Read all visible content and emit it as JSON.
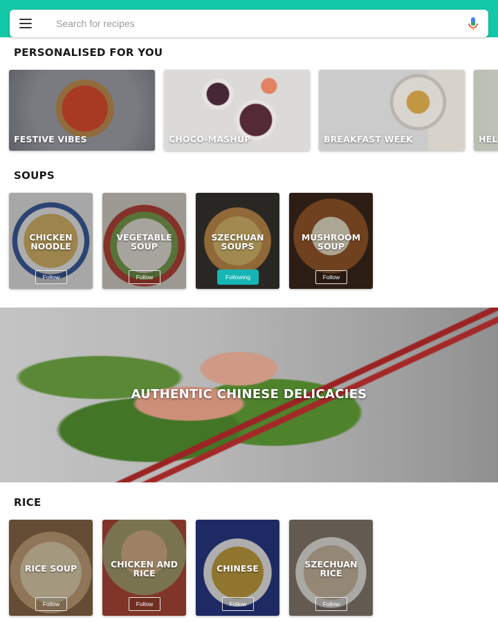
{
  "search": {
    "placeholder": "Search for recipes",
    "menu_icon": "hamburger-menu-icon",
    "voice_icon": "microphone-icon"
  },
  "colors": {
    "accent": "#13c8a8",
    "following": "#15b5b5"
  },
  "personalised": {
    "title": "PERSONALISED FOR YOU",
    "cards": [
      {
        "label": "FESTIVE VIBES"
      },
      {
        "label": "CHOCO-MASHUP"
      },
      {
        "label": "BREAKFAST WEEK"
      },
      {
        "label": "HEL"
      }
    ]
  },
  "soups": {
    "title": "SOUPS",
    "cards": [
      {
        "label": "CHICKEN\nNOODLE",
        "button": "Follow"
      },
      {
        "label": "VEGETABLE\nSOUP",
        "button": "Follow"
      },
      {
        "label": "SZECHUAN\nSOUPS",
        "button": "Following"
      },
      {
        "label": "MUSHROOM\nSOUP",
        "button": "Follow"
      }
    ]
  },
  "banner": {
    "label": "AUTHENTIC CHINESE DELICACIES"
  },
  "rice": {
    "title": "RICE",
    "cards": [
      {
        "label": "RICE SOUP",
        "button": "Follow"
      },
      {
        "label": "CHICKEN AND\nRICE",
        "button": "Follow"
      },
      {
        "label": "CHINESE",
        "button": "Follow"
      },
      {
        "label": "SZECHUAN\nRICE",
        "button": "Follow"
      }
    ]
  }
}
